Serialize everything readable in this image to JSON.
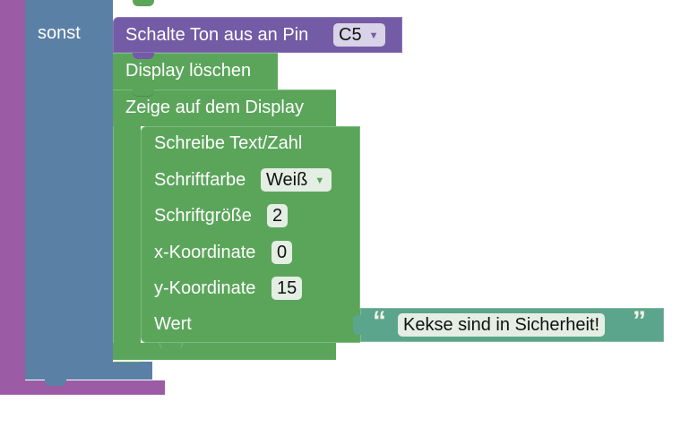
{
  "else_label": "sonst",
  "tone_block": {
    "label": "Schalte Ton aus an Pin",
    "pin_value": "C5"
  },
  "clear_block": {
    "label": "Display löschen"
  },
  "show_block": {
    "label": "Zeige auf dem Display"
  },
  "write_block": {
    "title": "Schreibe Text/Zahl",
    "font_color_label": "Schriftfarbe",
    "font_color_value": "Weiß",
    "font_size_label": "Schriftgröße",
    "font_size_value": "2",
    "x_label": "x-Koordinate",
    "x_value": "0",
    "y_label": "y-Koordinate",
    "y_value": "15",
    "value_label": "Wert"
  },
  "text_block": {
    "open_quote": "“",
    "text": "Kekse sind in Sicherheit!",
    "close_quote": "”"
  },
  "colors": {
    "purple_outer": "#9b5ba5",
    "blue_control": "#5b80a5",
    "purple_tone": "#745ba5",
    "green_display": "#5ba55b",
    "teal_text": "#5ba58c"
  }
}
